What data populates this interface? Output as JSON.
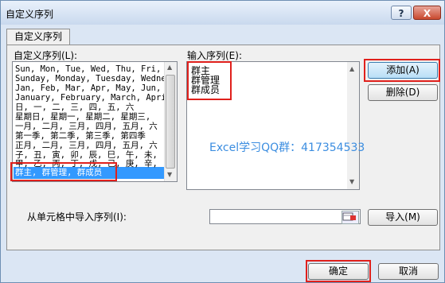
{
  "window": {
    "title": "自定义序列",
    "help_label": "?",
    "close_label": "X"
  },
  "tab": {
    "label": "自定义序列"
  },
  "left": {
    "label": "自定义序列(L):",
    "items": [
      "Sun, Mon, Tue, Wed, Thu, Fri, S",
      "Sunday, Monday, Tuesday, Wednes",
      "Jan, Feb, Mar, Apr, May, Jun, J",
      "January, February, March, April",
      "日, 一, 二, 三, 四, 五, 六",
      "星期日, 星期一, 星期二, 星期三,",
      "一月, 二月, 三月, 四月, 五月, 六",
      "第一季, 第二季, 第三季, 第四季",
      "正月, 二月, 三月, 四月, 五月, 六",
      "子, 丑, 寅, 卯, 辰, 巳, 午, 未,",
      "甲, 乙, 丙, 丁, 戊, 己, 庚, 辛,",
      "群主, 群管理, 群成员"
    ]
  },
  "right": {
    "label": "输入序列(E):",
    "entries": [
      "群主",
      "群管理",
      "群成员"
    ]
  },
  "buttons": {
    "add": "添加(A)",
    "delete": "删除(D)",
    "import": "导入(M)",
    "ok": "确定",
    "cancel": "取消"
  },
  "import_label": "从单元格中导入序列(I):",
  "watermark": "Excel学习QQ群：417354533",
  "colors": {
    "highlight": "#e0201c",
    "selection": "#3399ff",
    "watermark": "#3b8de0"
  }
}
